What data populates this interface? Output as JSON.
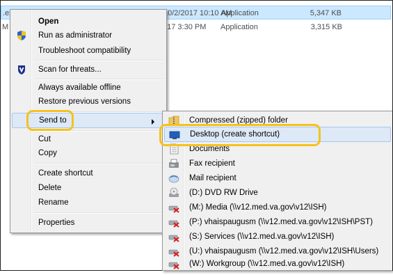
{
  "files": [
    {
      "name": ".ex",
      "date": "10/2/2017 10:10 AM",
      "type": "Application",
      "size": "5,347 KB"
    },
    {
      "name": "M",
      "date": "017 3:30 PM",
      "type": "Application",
      "size": "3,315 KB"
    }
  ],
  "context_menu": {
    "items": [
      {
        "label": "Open",
        "icon": "none"
      },
      {
        "label": "Run as administrator",
        "icon": "uac-shield-icon"
      },
      {
        "label": "Troubleshoot compatibility",
        "icon": "none"
      },
      {
        "label": "Scan for threats...",
        "icon": "antivirus-shield-icon"
      },
      {
        "label": "Always available offline",
        "icon": "none"
      },
      {
        "label": "Restore previous versions",
        "icon": "none"
      },
      {
        "label": "Send to",
        "icon": "none"
      },
      {
        "label": "Cut",
        "icon": "none"
      },
      {
        "label": "Copy",
        "icon": "none"
      },
      {
        "label": "Create shortcut",
        "icon": "none"
      },
      {
        "label": "Delete",
        "icon": "none"
      },
      {
        "label": "Rename",
        "icon": "none"
      },
      {
        "label": "Properties",
        "icon": "none"
      }
    ]
  },
  "send_to_menu": {
    "items": [
      {
        "label": "Compressed (zipped) folder",
        "icon": "zip-folder-icon"
      },
      {
        "label": "Desktop (create shortcut)",
        "icon": "desktop-icon"
      },
      {
        "label": "Documents",
        "icon": "documents-icon"
      },
      {
        "label": "Fax recipient",
        "icon": "fax-icon"
      },
      {
        "label": "Mail recipient",
        "icon": "mail-icon"
      },
      {
        "label": "(D:) DVD RW Drive",
        "icon": "dvd-drive-icon"
      },
      {
        "label": "(M:) Media (\\\\v12.med.va.gov\\v12\\ISH)",
        "icon": "disconnected-network-drive-icon"
      },
      {
        "label": "(P:) vhaispaugusm (\\\\v12.med.va.gov\\v12\\ISH\\PST)",
        "icon": "disconnected-network-drive-icon"
      },
      {
        "label": "(S:) Services (\\\\v12.med.va.gov\\v12\\ISH)",
        "icon": "disconnected-network-drive-icon"
      },
      {
        "label": "(U:) vhaispaugusm (\\\\v12.med.va.gov\\v12\\ISH\\Users)",
        "icon": "disconnected-network-drive-icon"
      },
      {
        "label": "(W:) Workgroup (\\\\v12.med.va.gov\\v12\\ISH)",
        "icon": "disconnected-network-drive-icon"
      }
    ]
  },
  "colors": {
    "highlight_ring": "#f5c21b",
    "menu_background": "#f0f0f0",
    "hover_background": "#dde9f7",
    "selection_background": "#cce8ff"
  }
}
